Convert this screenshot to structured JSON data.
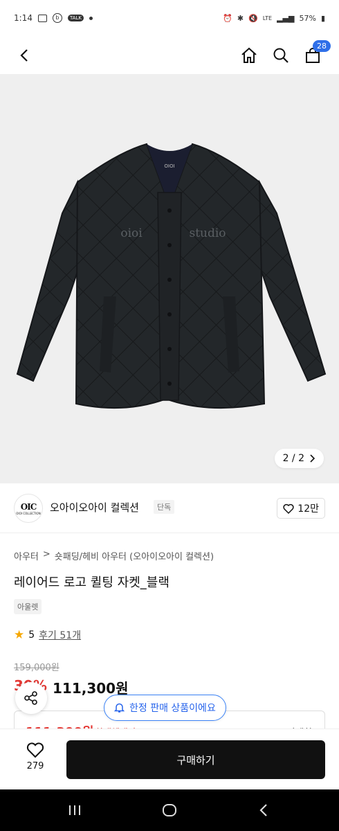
{
  "status_bar": {
    "time": "1:14",
    "battery": "57%"
  },
  "header": {
    "cart_count": "28"
  },
  "gallery": {
    "counter": "2 / 2",
    "print_left": "oioi",
    "print_right": "studio",
    "neck_label": "OIOI"
  },
  "brand": {
    "logo_text": "OIC",
    "logo_sub": "OIOI COLLECTION",
    "name": "오아이오아이 컬렉션",
    "tag": "단독",
    "likes": "12만"
  },
  "product": {
    "breadcrumb": [
      "아우터",
      ">",
      "숏패딩/헤비 아우터 (오아이오아이 컬렉션)"
    ],
    "title": "레이어드 로고 퀼팅 자켓_블랙",
    "chip": "아울렛",
    "rating": "5",
    "reviews": "후기 51개",
    "original_price": "159,000원",
    "discount": "30%",
    "sale_price": "111,300원",
    "benefit_price": "111,300원",
    "benefit_label": "최대혜택가",
    "benefit_more": "자세히"
  },
  "toast": {
    "text": "한정 판매 상품이에요"
  },
  "bottom": {
    "wish_count": "279",
    "buy_label": "구매하기"
  }
}
